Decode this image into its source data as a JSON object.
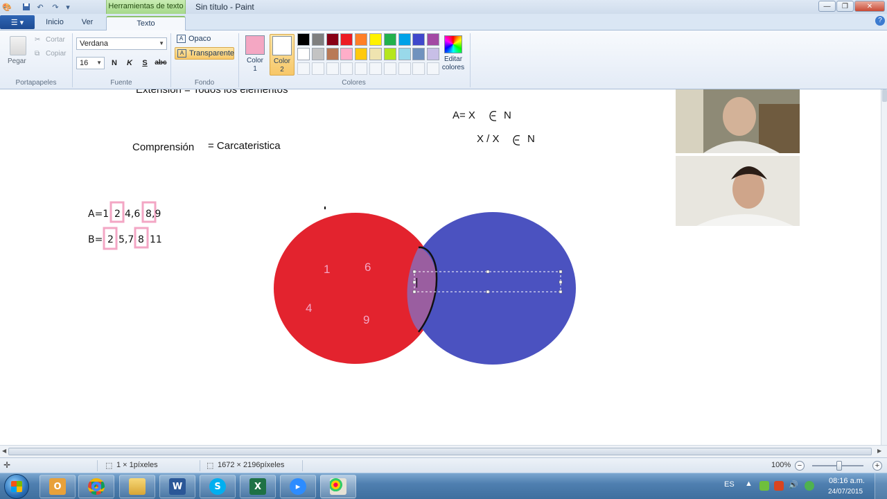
{
  "titlebar": {
    "context_tab_group": "Herramientas de texto",
    "window_title": "Sin título - Paint",
    "minimize": "—",
    "maximize": "❐",
    "close": "✕"
  },
  "tabs": [
    {
      "label": "Inicio"
    },
    {
      "label": "Ver"
    },
    {
      "label": "Texto"
    }
  ],
  "ribbon": {
    "clipboard": {
      "paste": "Pegar",
      "cut": "Cortar",
      "copy": "Copiar",
      "group": "Portapapeles"
    },
    "font": {
      "name": "Verdana",
      "size": "16",
      "bold": "N",
      "italic": "K",
      "underline": "S",
      "strikethrough": "abc",
      "group": "Fuente"
    },
    "background": {
      "opaque": "Opaco",
      "transparent": "Transparente",
      "group": "Fondo"
    },
    "colors": {
      "color1_line1": "Color",
      "color1_line2": "1",
      "color2_line1": "Color",
      "color2_line2": "2",
      "color1_value": "#f4a7c3",
      "color2_value": "#ffffff",
      "palette_row1": [
        "#000000",
        "#7f7f7f",
        "#880015",
        "#ed1c24",
        "#ff7f27",
        "#fff200",
        "#22b14c",
        "#00a2e8",
        "#3f48cc",
        "#a349a4"
      ],
      "palette_row2": [
        "#ffffff",
        "#c3c3c3",
        "#b97a57",
        "#ffaec9",
        "#ffc90e",
        "#efe4b0",
        "#b5e61d",
        "#99d9ea",
        "#7092be",
        "#c8bfe7"
      ],
      "edit_line1": "Editar",
      "edit_line2": "colores",
      "group": "Colores"
    }
  },
  "canvas": {
    "text_extension": "Extensión =  Todos los elementos",
    "text_comprehension_label": "Comprensión",
    "text_comprehension_value": "= Carcateristica",
    "text_set_def_line1": "A= X",
    "text_set_def_line1_n": "N",
    "text_set_def_line2": "X / X",
    "text_set_def_line2_n": "N",
    "set_a_prefix": "A=1",
    "set_a_boxed_1": "2",
    "set_a_mid": "4,6",
    "set_a_boxed_2": "8",
    "set_a_suffix": ",9",
    "set_b_prefix": "B=",
    "set_b_boxed_1": "2",
    "set_b_mid": "5,7",
    "set_b_boxed_2": "8",
    "set_b_suffix": "11",
    "venn_red_numbers": [
      "1",
      "6",
      "4",
      "9"
    ],
    "colors": {
      "red_circle": "#e3232e",
      "blue_circle": "#4b52c0",
      "intersection": "#9a5ea0",
      "pink_box": "#f3a6c4"
    }
  },
  "statusbar": {
    "selection_size": "1 × 1píxeles",
    "image_size": "1672 × 2196píxeles",
    "zoom": "100%",
    "zoom_value_fraction": 0.5
  },
  "taskbar": {
    "apps": [
      "outlook-icon",
      "chrome-icon",
      "file-explorer-icon",
      "word-icon",
      "skype-icon",
      "excel-icon",
      "zoom-icon",
      "paint-icon"
    ],
    "language": "ES",
    "time": "08:16 a.m.",
    "date": "24/07/2015"
  }
}
